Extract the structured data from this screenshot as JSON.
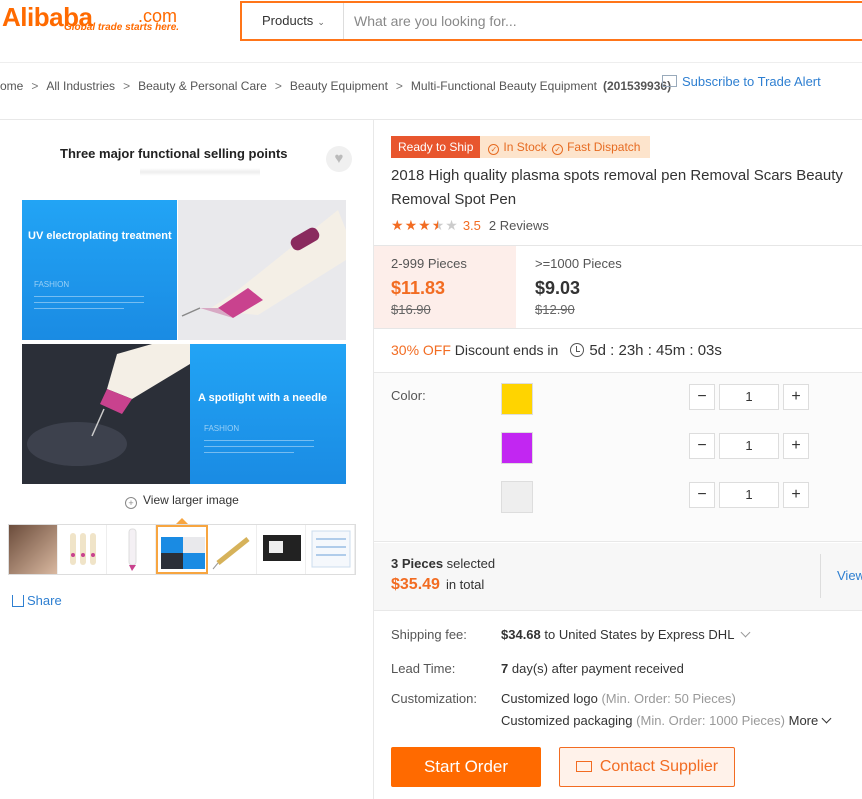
{
  "header": {
    "logo_text": "Alibaba",
    "logo_suffix": ".com",
    "logo_tagline": "Global trade starts here.",
    "search_category": "Products",
    "search_placeholder": "What are you looking for..."
  },
  "breadcrumb": {
    "items": [
      "ome",
      "All Industries",
      "Beauty & Personal Care",
      "Beauty Equipment",
      "Multi-Functional Beauty Equipment"
    ],
    "count": "(201539936)",
    "subscribe": "Subscribe to Trade Alert"
  },
  "gallery": {
    "headline": "Three major functional selling points",
    "panel1_text": "UV electroplating treatment",
    "panel1_sub": "FASHION",
    "panel4_text": "A spotlight with a needle",
    "panel4_sub": "FASHION",
    "view_larger": "View larger image",
    "share": "Share",
    "thumbnail_count": 7,
    "selected_thumbnail": 4
  },
  "product": {
    "badge_ready": "Ready to Ship",
    "badge_stock": "In Stock",
    "badge_dispatch": "Fast Dispatch",
    "title": "2018 High quality plasma spots removal pen Removal Scars Beauty Removal Spot Pen",
    "rating": "3.5",
    "rating_value": 3.5,
    "reviews": "2 Reviews"
  },
  "pricing": {
    "tiers": [
      {
        "qty": "2-999 Pieces",
        "price": "$11.83",
        "original": "$16.90"
      },
      {
        "qty": ">=1000 Pieces",
        "price": "$9.03",
        "original": "$12.90"
      }
    ],
    "discount_pct": "30% OFF",
    "discount_label": "Discount ends in",
    "countdown": "5d : 23h : 45m : 03s"
  },
  "options": {
    "color_label": "Color:",
    "colors": [
      {
        "hex": "#ffd400",
        "qty": "1"
      },
      {
        "hex": "#c226f2",
        "qty": "1"
      },
      {
        "hex": "#eeeeee",
        "qty": "1"
      }
    ],
    "minus": "−",
    "plus": "+"
  },
  "summary": {
    "qty": "3 Pieces",
    "selected": "selected",
    "total": "$35.49",
    "in_total": "in total",
    "view": "View"
  },
  "details": {
    "shipping_label": "Shipping fee:",
    "shipping_price": "$34.68",
    "shipping_text": "to United States by Express DHL",
    "lead_label": "Lead Time:",
    "lead_days": "7",
    "lead_text": "day(s) after payment received",
    "custom_label": "Customization:",
    "custom1": "Customized logo",
    "custom1_min": "(Min. Order: 50 Pieces)",
    "custom2": "Customized packaging",
    "custom2_min": "(Min. Order: 1000 Pieces)",
    "more": "More"
  },
  "actions": {
    "start_order": "Start Order",
    "contact": "Contact Supplier"
  },
  "colors": {
    "accent": "#ff6a00",
    "link": "#2e7fd1"
  }
}
